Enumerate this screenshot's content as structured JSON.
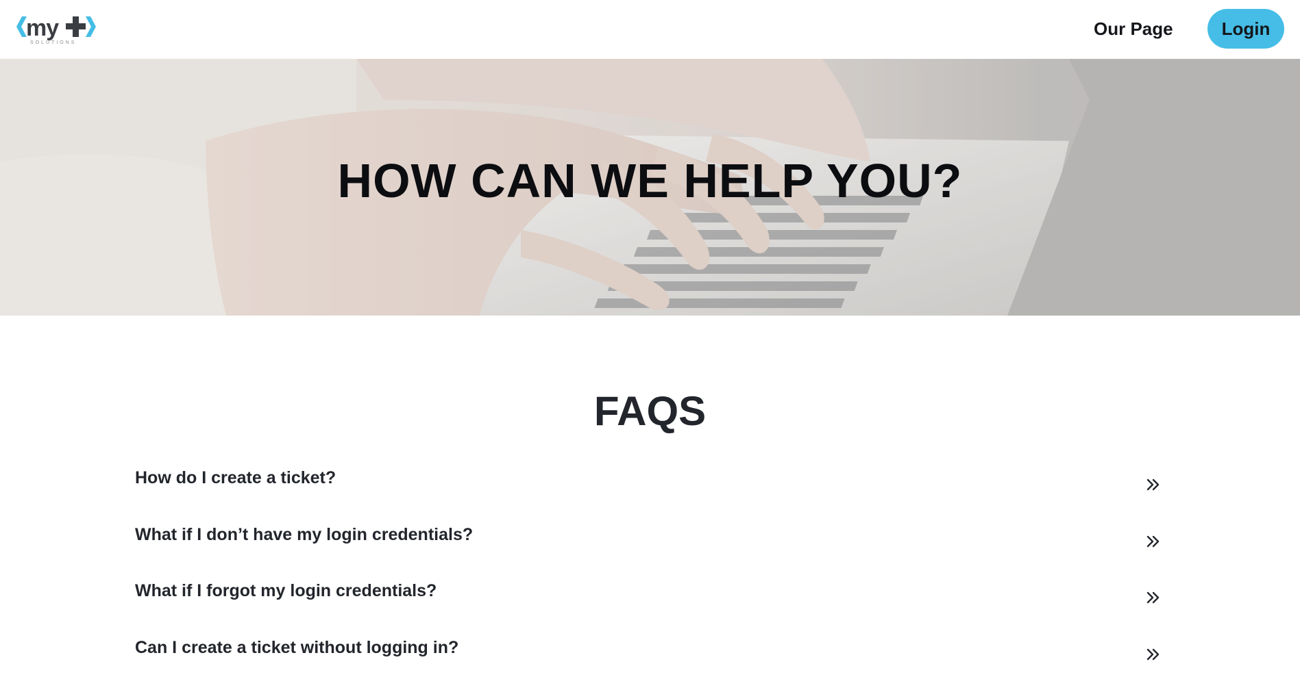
{
  "header": {
    "logo_alt": "my+ solutions",
    "logo_sub": "SOLUTIONS",
    "nav_link": "Our Page",
    "login_label": "Login"
  },
  "hero": {
    "title": "HOW CAN WE HELP YOU?"
  },
  "faq": {
    "title": "FAQS",
    "items": [
      {
        "question": "How do I create a ticket?"
      },
      {
        "question": "What if I don’t have my login credentials?"
      },
      {
        "question": "What if I forgot my login credentials?"
      },
      {
        "question": "Can I create a ticket without logging in?"
      }
    ]
  },
  "colors": {
    "accent": "#45bde6",
    "text": "#22252b",
    "background": "#ffffff"
  },
  "icons": {
    "faq_expand": "double-chevron-right-icon"
  }
}
